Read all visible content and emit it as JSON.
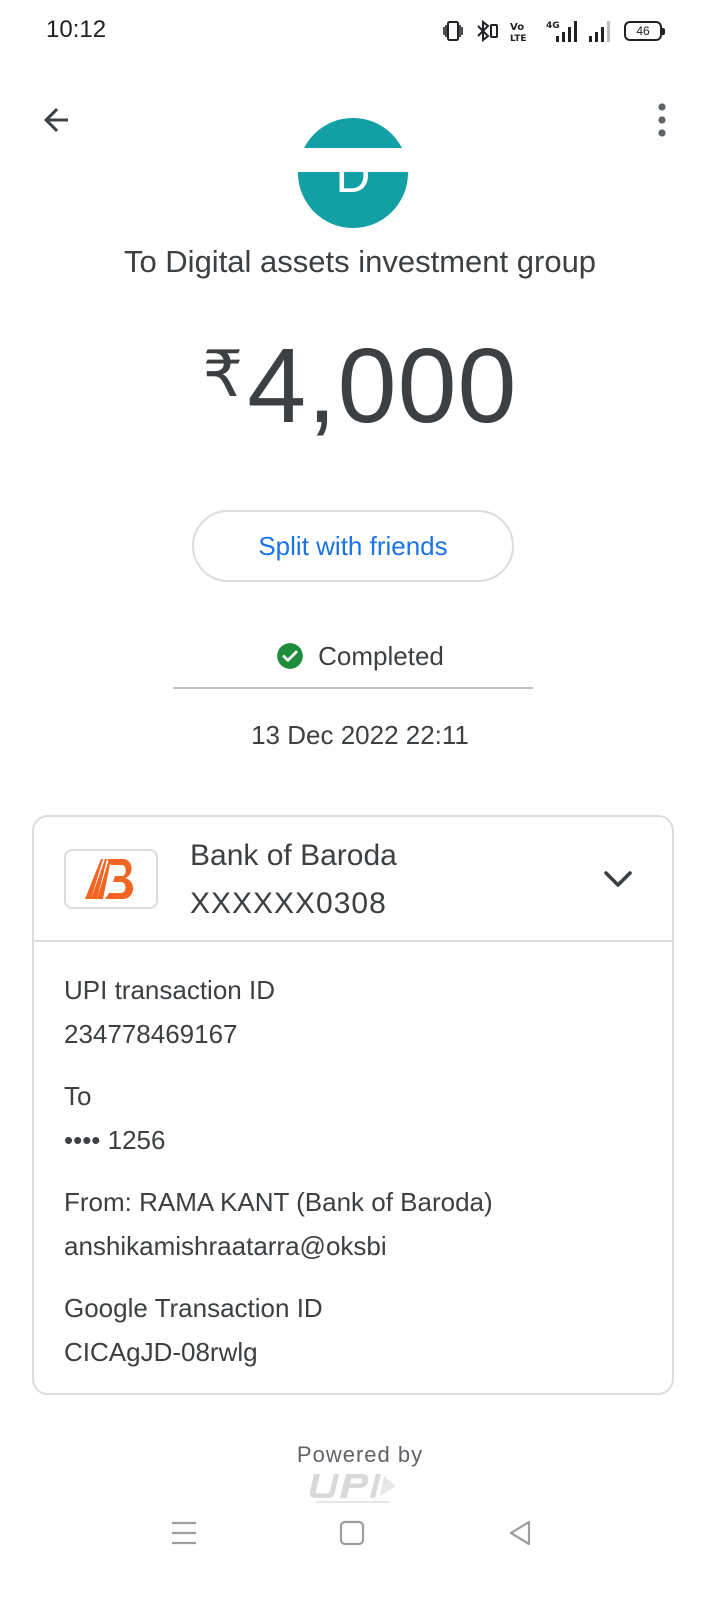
{
  "status_bar": {
    "time": "10:12",
    "battery": "46",
    "network": "4G",
    "icons": [
      "vibrate-icon",
      "bluetooth-icon",
      "volte-icon",
      "signal-4g-icon",
      "signal-icon",
      "battery-icon"
    ]
  },
  "app_bar": {
    "back_icon": "arrow-back-icon",
    "menu_icon": "more-vertical-icon"
  },
  "recipient": {
    "avatar_letter": "D",
    "avatar_color": "#12a0a5",
    "title": "To Digital assets investment group"
  },
  "payment": {
    "currency_symbol": "₹",
    "amount": "4,000",
    "split_label": "Split with friends",
    "status": "Completed",
    "status_color": "#1e8e3e",
    "datetime": "13 Dec 2022 22:11"
  },
  "bank": {
    "name": "Bank of Baroda",
    "account": "XXXXXX0308",
    "logo_color": "#f26522"
  },
  "details": [
    {
      "label": "UPI transaction ID",
      "value": "234778469167"
    },
    {
      "label": "To",
      "value": "•••• 1256"
    },
    {
      "label": "From: RAMA KANT (Bank of Baroda)",
      "value": "anshikamishraatarra@oksbi"
    },
    {
      "label": "Google Transaction ID",
      "value": "CICAgJD-08rwlg"
    }
  ],
  "footer": {
    "powered_by": "Powered by"
  },
  "accent_color": "#1a73e8"
}
